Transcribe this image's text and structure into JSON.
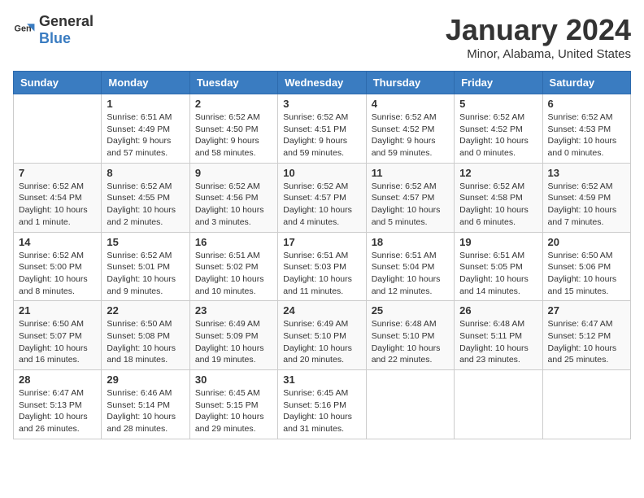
{
  "header": {
    "logo_general": "General",
    "logo_blue": "Blue",
    "title": "January 2024",
    "location": "Minor, Alabama, United States"
  },
  "weekdays": [
    "Sunday",
    "Monday",
    "Tuesday",
    "Wednesday",
    "Thursday",
    "Friday",
    "Saturday"
  ],
  "weeks": [
    [
      {
        "day": "",
        "detail": ""
      },
      {
        "day": "1",
        "detail": "Sunrise: 6:51 AM\nSunset: 4:49 PM\nDaylight: 9 hours\nand 57 minutes."
      },
      {
        "day": "2",
        "detail": "Sunrise: 6:52 AM\nSunset: 4:50 PM\nDaylight: 9 hours\nand 58 minutes."
      },
      {
        "day": "3",
        "detail": "Sunrise: 6:52 AM\nSunset: 4:51 PM\nDaylight: 9 hours\nand 59 minutes."
      },
      {
        "day": "4",
        "detail": "Sunrise: 6:52 AM\nSunset: 4:52 PM\nDaylight: 9 hours\nand 59 minutes."
      },
      {
        "day": "5",
        "detail": "Sunrise: 6:52 AM\nSunset: 4:52 PM\nDaylight: 10 hours\nand 0 minutes."
      },
      {
        "day": "6",
        "detail": "Sunrise: 6:52 AM\nSunset: 4:53 PM\nDaylight: 10 hours\nand 0 minutes."
      }
    ],
    [
      {
        "day": "7",
        "detail": "Sunrise: 6:52 AM\nSunset: 4:54 PM\nDaylight: 10 hours\nand 1 minute."
      },
      {
        "day": "8",
        "detail": "Sunrise: 6:52 AM\nSunset: 4:55 PM\nDaylight: 10 hours\nand 2 minutes."
      },
      {
        "day": "9",
        "detail": "Sunrise: 6:52 AM\nSunset: 4:56 PM\nDaylight: 10 hours\nand 3 minutes."
      },
      {
        "day": "10",
        "detail": "Sunrise: 6:52 AM\nSunset: 4:57 PM\nDaylight: 10 hours\nand 4 minutes."
      },
      {
        "day": "11",
        "detail": "Sunrise: 6:52 AM\nSunset: 4:57 PM\nDaylight: 10 hours\nand 5 minutes."
      },
      {
        "day": "12",
        "detail": "Sunrise: 6:52 AM\nSunset: 4:58 PM\nDaylight: 10 hours\nand 6 minutes."
      },
      {
        "day": "13",
        "detail": "Sunrise: 6:52 AM\nSunset: 4:59 PM\nDaylight: 10 hours\nand 7 minutes."
      }
    ],
    [
      {
        "day": "14",
        "detail": "Sunrise: 6:52 AM\nSunset: 5:00 PM\nDaylight: 10 hours\nand 8 minutes."
      },
      {
        "day": "15",
        "detail": "Sunrise: 6:52 AM\nSunset: 5:01 PM\nDaylight: 10 hours\nand 9 minutes."
      },
      {
        "day": "16",
        "detail": "Sunrise: 6:51 AM\nSunset: 5:02 PM\nDaylight: 10 hours\nand 10 minutes."
      },
      {
        "day": "17",
        "detail": "Sunrise: 6:51 AM\nSunset: 5:03 PM\nDaylight: 10 hours\nand 11 minutes."
      },
      {
        "day": "18",
        "detail": "Sunrise: 6:51 AM\nSunset: 5:04 PM\nDaylight: 10 hours\nand 12 minutes."
      },
      {
        "day": "19",
        "detail": "Sunrise: 6:51 AM\nSunset: 5:05 PM\nDaylight: 10 hours\nand 14 minutes."
      },
      {
        "day": "20",
        "detail": "Sunrise: 6:50 AM\nSunset: 5:06 PM\nDaylight: 10 hours\nand 15 minutes."
      }
    ],
    [
      {
        "day": "21",
        "detail": "Sunrise: 6:50 AM\nSunset: 5:07 PM\nDaylight: 10 hours\nand 16 minutes."
      },
      {
        "day": "22",
        "detail": "Sunrise: 6:50 AM\nSunset: 5:08 PM\nDaylight: 10 hours\nand 18 minutes."
      },
      {
        "day": "23",
        "detail": "Sunrise: 6:49 AM\nSunset: 5:09 PM\nDaylight: 10 hours\nand 19 minutes."
      },
      {
        "day": "24",
        "detail": "Sunrise: 6:49 AM\nSunset: 5:10 PM\nDaylight: 10 hours\nand 20 minutes."
      },
      {
        "day": "25",
        "detail": "Sunrise: 6:48 AM\nSunset: 5:10 PM\nDaylight: 10 hours\nand 22 minutes."
      },
      {
        "day": "26",
        "detail": "Sunrise: 6:48 AM\nSunset: 5:11 PM\nDaylight: 10 hours\nand 23 minutes."
      },
      {
        "day": "27",
        "detail": "Sunrise: 6:47 AM\nSunset: 5:12 PM\nDaylight: 10 hours\nand 25 minutes."
      }
    ],
    [
      {
        "day": "28",
        "detail": "Sunrise: 6:47 AM\nSunset: 5:13 PM\nDaylight: 10 hours\nand 26 minutes."
      },
      {
        "day": "29",
        "detail": "Sunrise: 6:46 AM\nSunset: 5:14 PM\nDaylight: 10 hours\nand 28 minutes."
      },
      {
        "day": "30",
        "detail": "Sunrise: 6:45 AM\nSunset: 5:15 PM\nDaylight: 10 hours\nand 29 minutes."
      },
      {
        "day": "31",
        "detail": "Sunrise: 6:45 AM\nSunset: 5:16 PM\nDaylight: 10 hours\nand 31 minutes."
      },
      {
        "day": "",
        "detail": ""
      },
      {
        "day": "",
        "detail": ""
      },
      {
        "day": "",
        "detail": ""
      }
    ]
  ]
}
